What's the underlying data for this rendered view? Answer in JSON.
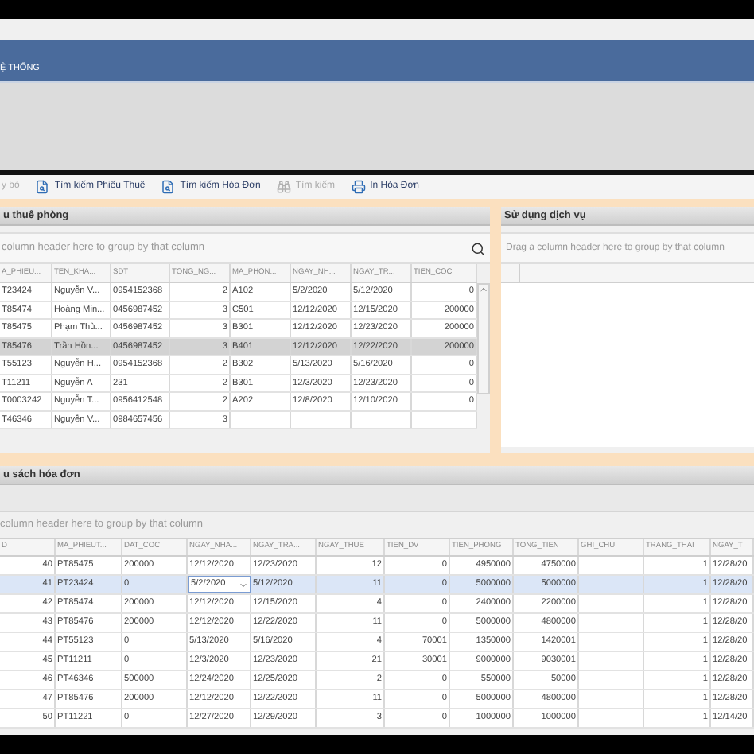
{
  "ribbon": {
    "tab": "Ệ THỐNG"
  },
  "toolbar": [
    {
      "kind": "plain",
      "label": "y bỏ",
      "disabled": true
    },
    {
      "kind": "search",
      "label": "Tìm kiếm Phiếu Thuê",
      "disabled": false
    },
    {
      "kind": "search",
      "label": "Tìm kiếm Hóa Đơn",
      "disabled": false
    },
    {
      "kind": "binoculars",
      "label": "Tìm kiếm",
      "disabled": true
    },
    {
      "kind": "print",
      "label": "In Hóa Đơn",
      "disabled": false
    }
  ],
  "rental_panel": {
    "title": "u thuê phòng",
    "group_hint": "column header here to group by that column",
    "columns": [
      "A_PHIEU...",
      "TEN_KHA...",
      "SDT",
      "TONG_NG...",
      "MA_PHON...",
      "NGAY_NH...",
      "NGAY_TR...",
      "TIEN_COC"
    ],
    "rows": [
      {
        "selected": false,
        "cells": [
          "T23424",
          "Nguyễn V...",
          "0954152368",
          "2",
          "A102",
          "5/2/2020",
          "5/12/2020",
          "0"
        ]
      },
      {
        "selected": false,
        "cells": [
          "T85474",
          "Hoàng Min...",
          "0456987452",
          "3",
          "C501",
          "12/12/2020",
          "12/15/2020",
          "200000"
        ]
      },
      {
        "selected": false,
        "cells": [
          "T85475",
          "Phạm Thù...",
          "0456987452",
          "3",
          "B301",
          "12/12/2020",
          "12/23/2020",
          "200000"
        ]
      },
      {
        "selected": true,
        "cells": [
          "T85476",
          "Trần Hồn...",
          "0456987452",
          "3",
          "B401",
          "12/12/2020",
          "12/22/2020",
          "200000"
        ]
      },
      {
        "selected": false,
        "cells": [
          "T55123",
          "Nguyễn H...",
          "0954152368",
          "2",
          "B302",
          "5/13/2020",
          "5/16/2020",
          "0"
        ]
      },
      {
        "selected": false,
        "cells": [
          "T11211",
          "Nguyễn A",
          "231",
          "2",
          "B301",
          "12/3/2020",
          "12/23/2020",
          "0"
        ]
      },
      {
        "selected": false,
        "cells": [
          "T0003242",
          "Nguyễn T...",
          "0956412548",
          "2",
          "A202",
          "12/8/2020",
          "12/10/2020",
          "0"
        ]
      },
      {
        "selected": false,
        "cells": [
          "T46346",
          "Nguyễn V...",
          "0984657456",
          "3",
          null,
          null,
          null,
          null
        ]
      }
    ]
  },
  "service_panel": {
    "title": "Sử dụng dịch vụ",
    "group_hint": "Drag a column header here to group by that column"
  },
  "invoice_panel": {
    "title": "u sách hóa đơn",
    "group_hint": "column header here to group by that column",
    "columns": [
      "D",
      "MA_PHIEUT...",
      "DAT_COC",
      "NGAY_NHA...",
      "NGAY_TRA...",
      "NGAY_THUE",
      "TIEN_DV",
      "TIEN_PHONG",
      "TONG_TIEN",
      "GHI_CHU",
      "TRANG_THAI",
      "NGAY_T"
    ],
    "rows": [
      {
        "selected": false,
        "cells": [
          "40",
          "PT85475",
          "200000",
          "12/12/2020",
          "12/23/2020",
          "12",
          "0",
          "4950000",
          "4750000",
          null,
          "1",
          "12/28/20"
        ]
      },
      {
        "selected": true,
        "cells": [
          "41",
          "PT23424",
          "0",
          {
            "text": "5/2/2020",
            "editing": true
          },
          "5/12/2020",
          "11",
          "0",
          "5000000",
          "5000000",
          null,
          "1",
          "12/28/20"
        ]
      },
      {
        "selected": false,
        "cells": [
          "42",
          "PT85474",
          "200000",
          "12/12/2020",
          "12/15/2020",
          "4",
          "0",
          "2400000",
          "2200000",
          null,
          "1",
          "12/28/20"
        ]
      },
      {
        "selected": false,
        "cells": [
          "43",
          "PT85476",
          "200000",
          "12/12/2020",
          "12/22/2020",
          "11",
          "0",
          "5000000",
          "4800000",
          null,
          "1",
          "12/28/20"
        ]
      },
      {
        "selected": false,
        "cells": [
          "44",
          "PT55123",
          "0",
          "5/13/2020",
          "5/16/2020",
          "4",
          "70001",
          "1350000",
          "1420001",
          null,
          "1",
          "12/28/20"
        ]
      },
      {
        "selected": false,
        "cells": [
          "45",
          "PT11211",
          "0",
          "12/3/2020",
          "12/23/2020",
          "21",
          "30001",
          "9000000",
          "9030001",
          null,
          "1",
          "12/28/20"
        ]
      },
      {
        "selected": false,
        "cells": [
          "46",
          "PT46346",
          "500000",
          "12/24/2020",
          "12/25/2020",
          "2",
          "0",
          "550000",
          "50000",
          null,
          "1",
          "12/28/20"
        ]
      },
      {
        "selected": false,
        "cells": [
          "47",
          "PT85476",
          "200000",
          "12/12/2020",
          "12/22/2020",
          "11",
          "0",
          "5000000",
          "4800000",
          null,
          "1",
          "12/28/20"
        ]
      },
      {
        "selected": false,
        "cells": [
          "50",
          "PT11221",
          "0",
          "12/27/2020",
          "12/29/2020",
          "3",
          "0",
          "1000000",
          "1000000",
          null,
          "1",
          "12/14/20"
        ]
      }
    ]
  }
}
